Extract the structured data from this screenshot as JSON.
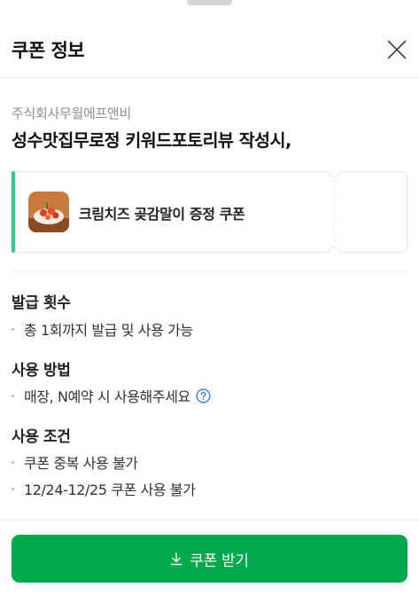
{
  "header": {
    "title": "쿠폰 정보"
  },
  "store": {
    "company": "주식회사무월에프앤비",
    "name": "성수맛집무로정 키워드포토리뷰 작성시,"
  },
  "coupon": {
    "name": "크림치즈 곶감말이 증정 쿠폰",
    "accent_color": "#2ed18a"
  },
  "sections": [
    {
      "title": "발급 횟수",
      "items": [
        "총 1회까지 발급 및 사용 가능"
      ]
    },
    {
      "title": "사용 방법",
      "items": [
        "매장, N예약 시 사용해주세요"
      ]
    },
    {
      "title": "사용 조건",
      "items": [
        "쿠폰 중복 사용 불가",
        "12/24-12/25 쿠폰 사용 불가"
      ]
    }
  ],
  "cta": {
    "label": "쿠폰 받기",
    "color": "#03a94d"
  }
}
